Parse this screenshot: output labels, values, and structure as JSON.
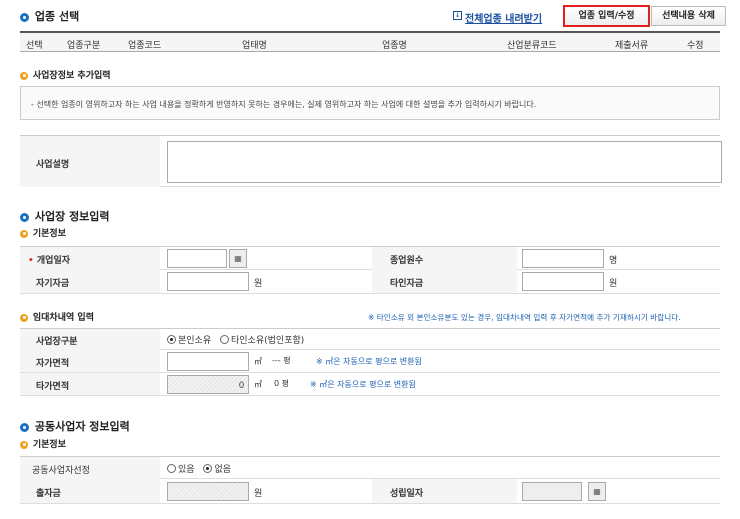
{
  "industry": {
    "title": "업종 선택",
    "download_link": "전체업종 내려받기",
    "edit_button": "업종 입력/수정",
    "delete_button": "선택내용 삭제",
    "columns": [
      "선택",
      "업종구분",
      "업종코드",
      "업태명",
      "업종명",
      "산업분류코드",
      "제출서류",
      "수정"
    ]
  },
  "additional": {
    "title": "사업장정보 추가입력",
    "note": "- 선택한 업종이 영위하고자 하는 사업 내용을 정확하게 반영하지 못하는 경우에는, 실제 영위하고자 하는 사업에 대한 설명을 추가 입력하시기 바랍니다.",
    "desc_label": "사업설명",
    "desc_value": ""
  },
  "business": {
    "title": "사업장 정보입력",
    "basic_title": "기본정보",
    "required_mark": "•",
    "open_date_label": "개업일자",
    "open_date_value": "",
    "employees_label": "종업원수",
    "employees_value": "",
    "employees_unit": "명",
    "own_funds_label": "자기자금",
    "own_funds_value": "",
    "own_funds_unit": "원",
    "other_funds_label": "타인자금",
    "other_funds_value": "",
    "other_funds_unit": "원",
    "calendar_icon": "calendar-icon"
  },
  "lease": {
    "title": "임대차내역 입력",
    "hint": "※ 타인소유 외 본인소유분도 있는 경우, 임대차내역 입력 후 자가면적에 추가 기재하시기 바랍니다.",
    "type_label": "사업장구분",
    "option_own": "본인소유",
    "option_other": "타인소유(법인포함)",
    "selected": "본인소유",
    "own_area_label": "자가면적",
    "own_area_value": "",
    "area_unit": "㎡",
    "own_area_pyeong": "--- 평",
    "own_area_note": "※ ㎡은 자동으로 평으로 변환됨",
    "other_area_label": "타가면적",
    "other_area_value": "0",
    "other_area_pyeong": "0 평",
    "other_area_note": "※ ㎡은 자동으로 평으로 변환됨"
  },
  "joint": {
    "title": "공동사업자 정보입력",
    "basic_title": "기본정보",
    "select_label": "공동사업자선정",
    "option_yes": "있음",
    "option_no": "없음",
    "selected": "없음",
    "investment_label": "출자금",
    "investment_value": "",
    "investment_unit": "원",
    "established_label": "성립일자",
    "established_value": ""
  }
}
